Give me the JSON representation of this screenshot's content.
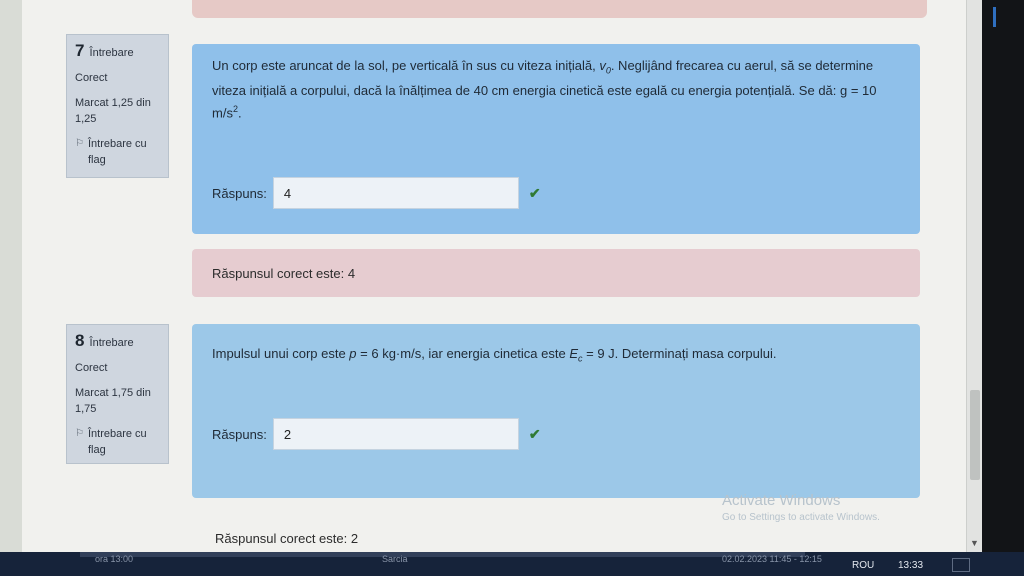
{
  "questions": [
    {
      "number": "7",
      "word": "Întrebare",
      "status": "Corect",
      "mark": "Marcat 1,25 din 1,25",
      "flag_label": "Întrebare cu flag",
      "text_parts": {
        "before_v0": "Un corp este aruncat de la sol, pe verticală în sus cu viteza inițială, ",
        "v0": "v",
        "v0_sub": "0",
        "after_v0": ". Neglijând frecarea cu aerul, să se determine viteza inițială a corpului, dacă la înălțimea de 40 cm energia cinetică este egală cu energia potențială. Se dă: g = 10 m/s",
        "sup": "2",
        "end": "."
      },
      "answer_label": "Răspuns:",
      "answer_value": "4",
      "correct_answer": "Răspunsul corect este: 4"
    },
    {
      "number": "8",
      "word": "Întrebare",
      "status": "Corect",
      "mark": "Marcat 1,75 din 1,75",
      "flag_label": "Întrebare cu flag",
      "text_parts": {
        "before_p": "Impulsul unui corp este ",
        "p": "p",
        "mid": " = 6 kg·m/s, iar energia cinetica este ",
        "E": "E",
        "E_sub": "c",
        "after": " = 9 J. Determinați masa corpului."
      },
      "answer_label": "Răspuns:",
      "answer_value": "2",
      "correct_answer": "Răspunsul corect este: 2"
    }
  ],
  "watermark": {
    "title": "Activate Windows",
    "subtitle": "Go to Settings to activate Windows."
  },
  "taskbar": {
    "left_text": "ora 13:00",
    "mid_text": "Sarcia",
    "right_text": "02.02.2023 11:45 - 12:15",
    "lang": "ROU",
    "time": "13:33"
  },
  "colors": {
    "question_bg": "#8fc0ea",
    "feedback_bg": "#e6ccd0",
    "info_bg": "#cfd6df",
    "check": "#2f7a34"
  }
}
